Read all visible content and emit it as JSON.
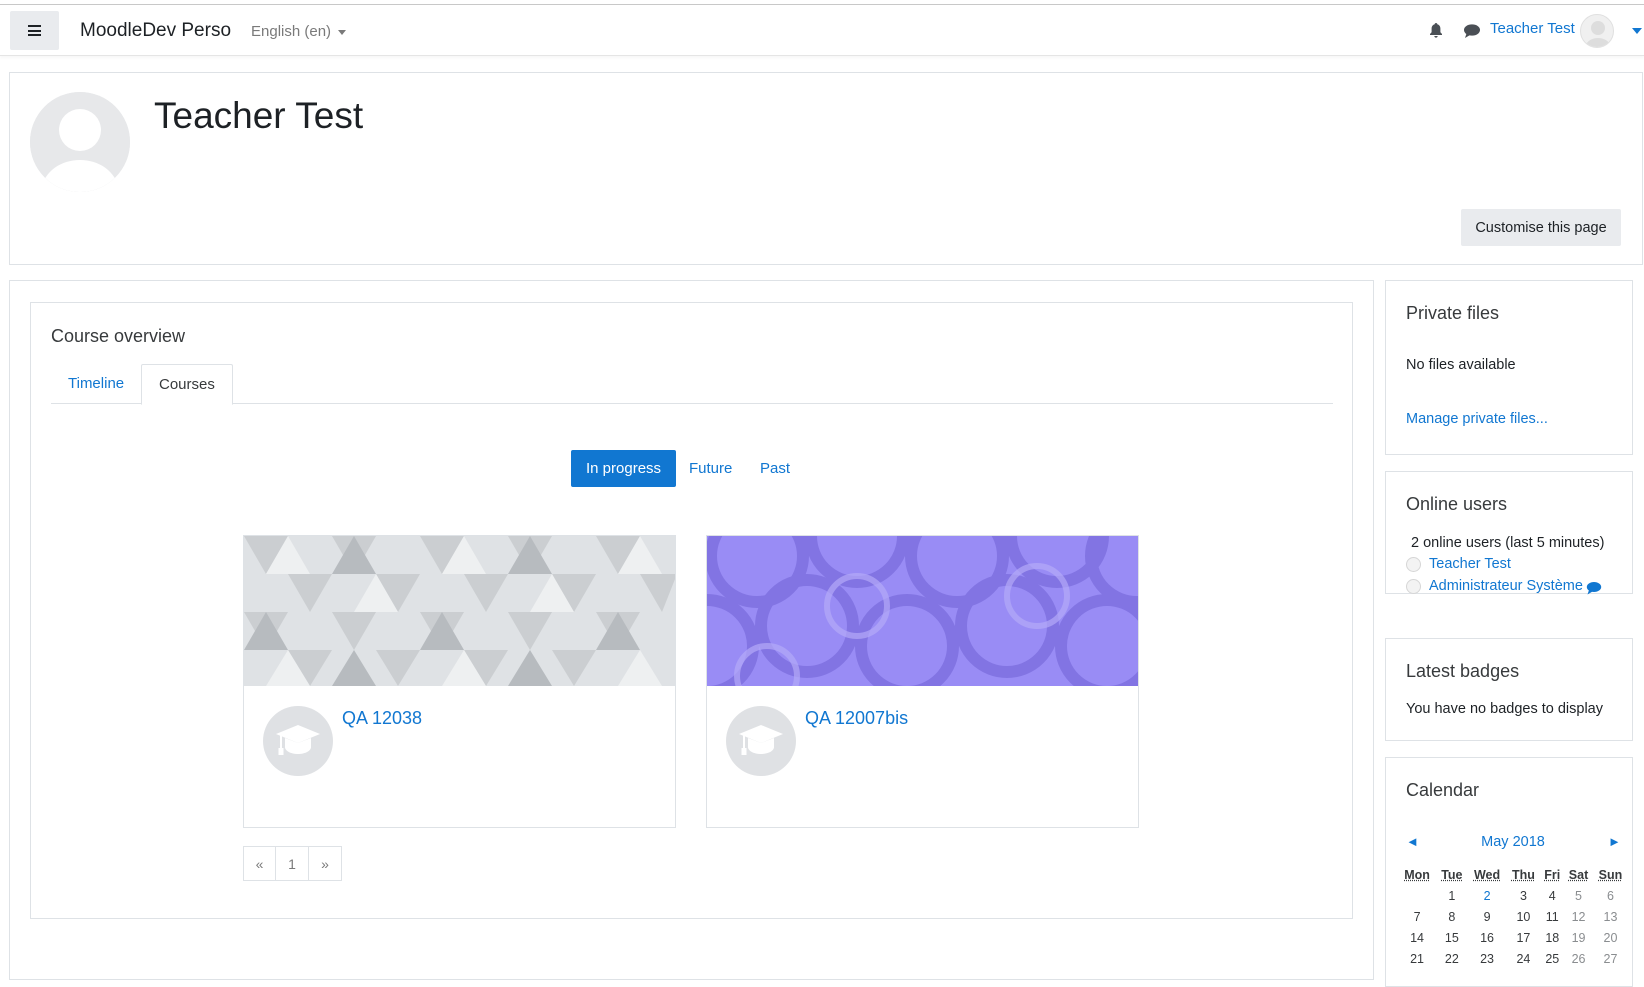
{
  "navbar": {
    "site_name": "MoodleDev Perso",
    "language": "English (en)",
    "user_name": "Teacher Test"
  },
  "header": {
    "title": "Teacher Test",
    "customise_label": "Customise this page"
  },
  "course_overview": {
    "title": "Course overview",
    "tabs": [
      "Timeline",
      "Courses"
    ],
    "active_tab": "Courses",
    "filters": [
      "In progress",
      "Future",
      "Past"
    ],
    "active_filter": "In progress",
    "courses": [
      {
        "name": "QA 12038"
      },
      {
        "name": "QA 12007bis"
      }
    ],
    "pagination": {
      "prev": "«",
      "page": "1",
      "next": "»"
    }
  },
  "private_files": {
    "title": "Private files",
    "empty": "No files available",
    "manage": "Manage private files..."
  },
  "online_users": {
    "title": "Online users",
    "summary": "2 online users (last 5 minutes)",
    "users": [
      "Teacher Test",
      "Administrateur Système"
    ]
  },
  "badges": {
    "title": "Latest badges",
    "empty": "You have no badges to display"
  },
  "calendar": {
    "title": "Calendar",
    "month": "May 2018",
    "prev": "◄",
    "next": "►",
    "days": [
      "Mon",
      "Tue",
      "Wed",
      "Thu",
      "Fri",
      "Sat",
      "Sun"
    ],
    "weeks": [
      [
        "",
        "1",
        "2",
        "3",
        "4",
        "5",
        "6"
      ],
      [
        "7",
        "8",
        "9",
        "10",
        "11",
        "12",
        "13"
      ],
      [
        "14",
        "15",
        "16",
        "17",
        "18",
        "19",
        "20"
      ],
      [
        "21",
        "22",
        "23",
        "24",
        "25",
        "26",
        "27"
      ]
    ]
  }
}
